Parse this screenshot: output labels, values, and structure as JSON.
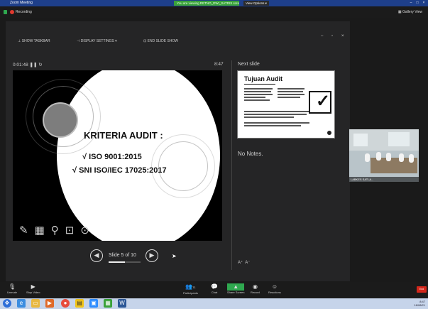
{
  "titlebar": {
    "title": "Zoom Meeting",
    "share_label": "You are viewing RETNO_DWI_SATRIS screen",
    "view_options": "View Options ▾"
  },
  "top": {
    "recording": "Recording",
    "gallery_view": "Gallery View"
  },
  "presenter_toolbar": {
    "show_taskbar": "SHOW TASKBAR",
    "display_settings": "DISPLAY SETTINGS ▾",
    "end_show": "END SLIDE SHOW"
  },
  "presenter": {
    "timer": "0:01:48",
    "clock": "8:47"
  },
  "slide": {
    "title": "KRITERIA AUDIT :",
    "line1": "√ ISO 9001:2015",
    "line2": "√ SNI ISO/IEC 17025:2017"
  },
  "navigation": {
    "label": "Slide 5 of 10",
    "progress": 0.5
  },
  "next_slide": {
    "header": "Next slide",
    "title": "Tujuan Audit"
  },
  "notes": "No Notes.",
  "video": {
    "name": "LABKES SATLA..."
  },
  "zoom_bar": {
    "unmute": "Unmute",
    "stop_video": "Stop Video",
    "participants": "Participants",
    "participants_count": "71",
    "chat": "Chat",
    "share_screen": "Share Screen",
    "record": "Record",
    "reactions": "Reactions",
    "end": "End"
  },
  "tray": {
    "time": "8:47",
    "date": "16/08/21"
  },
  "colors": {
    "slide_bg": "#000000",
    "oval": "#ffffff",
    "zoom_green": "#2fa84f",
    "end_red": "#d4271b",
    "title_blue": "#1e3f8a"
  }
}
